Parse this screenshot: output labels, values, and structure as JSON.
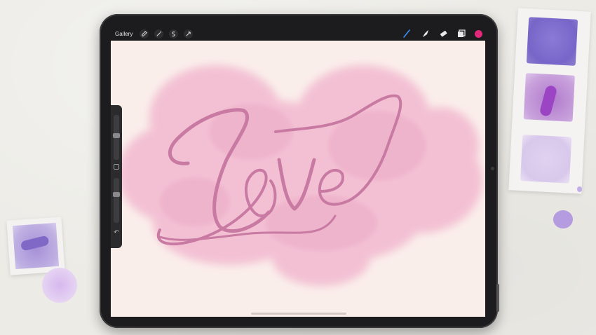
{
  "topbar": {
    "gallery_label": "Gallery",
    "left_tools": [
      {
        "name": "actions",
        "icon": "wrench-icon"
      },
      {
        "name": "adjustments",
        "icon": "magic-wand-icon"
      },
      {
        "name": "selection",
        "icon": "selection-s-icon"
      },
      {
        "name": "transform",
        "icon": "arrow-cursor-icon"
      }
    ],
    "right_tools": [
      {
        "name": "brush",
        "icon": "brush-icon",
        "active": true
      },
      {
        "name": "smudge",
        "icon": "smudge-icon"
      },
      {
        "name": "eraser",
        "icon": "eraser-icon"
      },
      {
        "name": "layers",
        "icon": "layers-icon"
      }
    ],
    "current_color": "#e2287a"
  },
  "canvas": {
    "background_color": "#faeeeb",
    "watercolor_color": "#f2b8cf",
    "lettering_color": "#c87aa3"
  },
  "colors": {
    "accent_active_tool": "#3a8ff5",
    "device_frame": "#1c1c1e",
    "table_background": "#ecebe6"
  }
}
